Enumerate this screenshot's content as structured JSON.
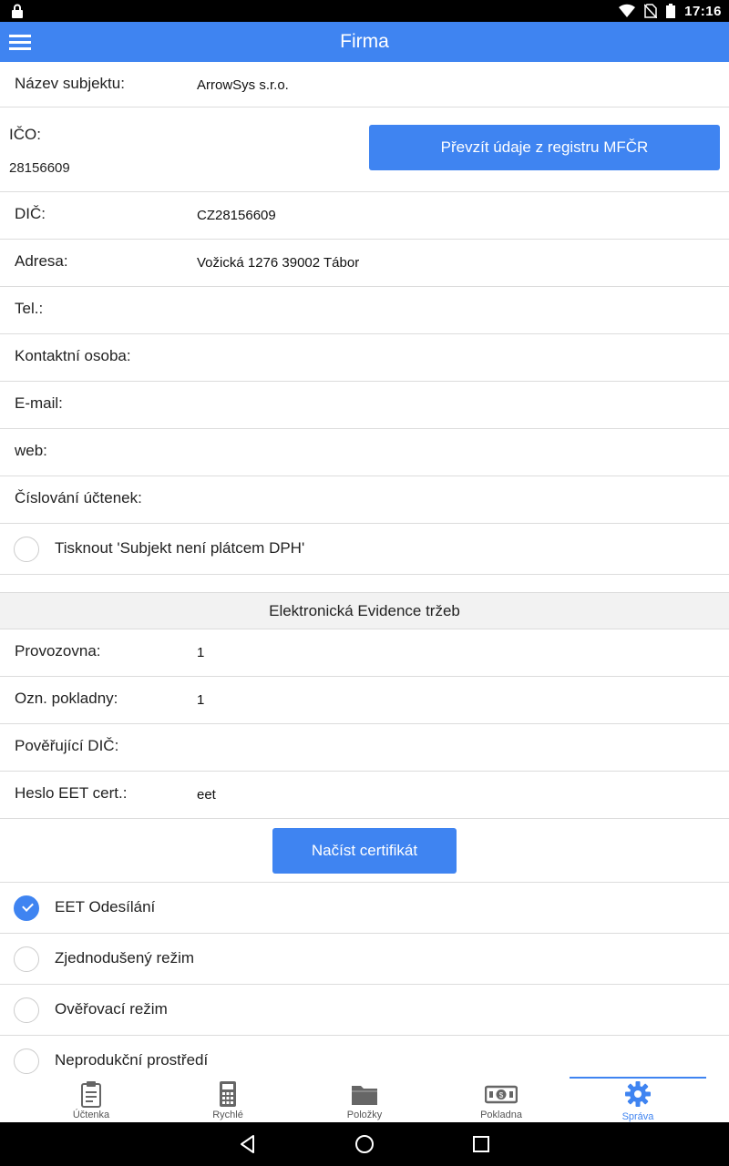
{
  "status_bar": {
    "time": "17:16"
  },
  "app_bar": {
    "title": "Firma"
  },
  "company": {
    "name_label": "Název subjektu:",
    "name_value": "ArrowSys s.r.o.",
    "ico_label": "IČO:",
    "ico_value": "28156609",
    "registry_button": "Převzít údaje z registru MFČR",
    "dic_label": "DIČ:",
    "dic_value": "CZ28156609",
    "address_label": "Adresa:",
    "address_value": "Vožická 1276 39002 Tábor",
    "tel_label": "Tel.:",
    "contact_label": "Kontaktní osoba:",
    "email_label": "E-mail:",
    "web_label": "web:",
    "numbering_label": "Číslování účtenek:",
    "vat_print_label": "Tisknout 'Subjekt není plátcem DPH'",
    "vat_print_checked": false
  },
  "eet": {
    "section_title": "Elektronická Evidence tržeb",
    "premises_label": "Provozovna:",
    "premises_value": "1",
    "register_label": "Ozn. pokladny:",
    "register_value": "1",
    "authorizing_dic_label": "Pověřující DIČ:",
    "cert_password_label": "Heslo EET cert.:",
    "cert_password_value": "eet",
    "load_cert_button": "Načíst certifikát",
    "options": [
      {
        "label": "EET Odesílání",
        "checked": true
      },
      {
        "label": "Zjednodušený režim",
        "checked": false
      },
      {
        "label": "Ověřovací režim",
        "checked": false
      },
      {
        "label": "Neprodukční prostředí",
        "checked": false
      }
    ]
  },
  "bottom_nav": {
    "items": [
      {
        "label": "Účtenka",
        "icon": "clipboard-icon"
      },
      {
        "label": "Rychlé",
        "icon": "calculator-icon"
      },
      {
        "label": "Položky",
        "icon": "folder-icon"
      },
      {
        "label": "Pokladna",
        "icon": "cash-icon"
      },
      {
        "label": "Správa",
        "icon": "gear-icon"
      }
    ],
    "active_index": 4,
    "accent_color": "#3f84f1"
  }
}
